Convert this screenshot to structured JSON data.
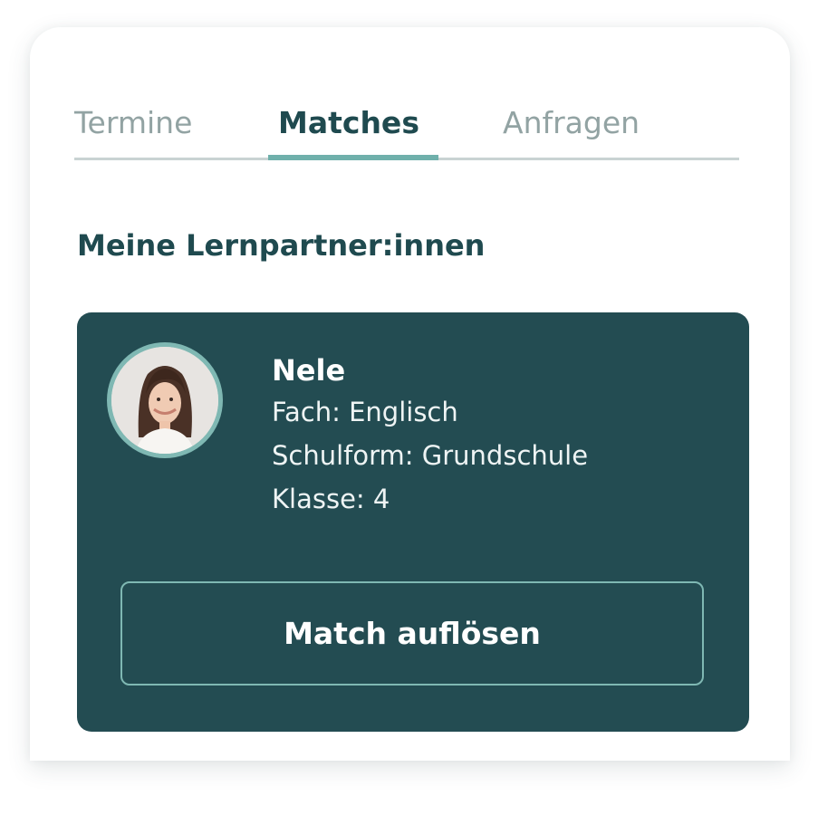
{
  "tabs": [
    {
      "label": "Termine",
      "active": false
    },
    {
      "label": "Matches",
      "active": true
    },
    {
      "label": "Anfragen",
      "active": false
    }
  ],
  "section_title": "Meine Lernpartner:innen",
  "match": {
    "name": "Nele",
    "fach": "Fach: Englisch",
    "schulform": "Schulform: Grundschule",
    "klasse": "Klasse: 4",
    "action_label": "Match auflösen"
  },
  "colors": {
    "primary_dark": "#234c52",
    "accent": "#6fb0ab",
    "text_dark": "#1f4a4f",
    "tab_inactive": "#92a3a3"
  }
}
